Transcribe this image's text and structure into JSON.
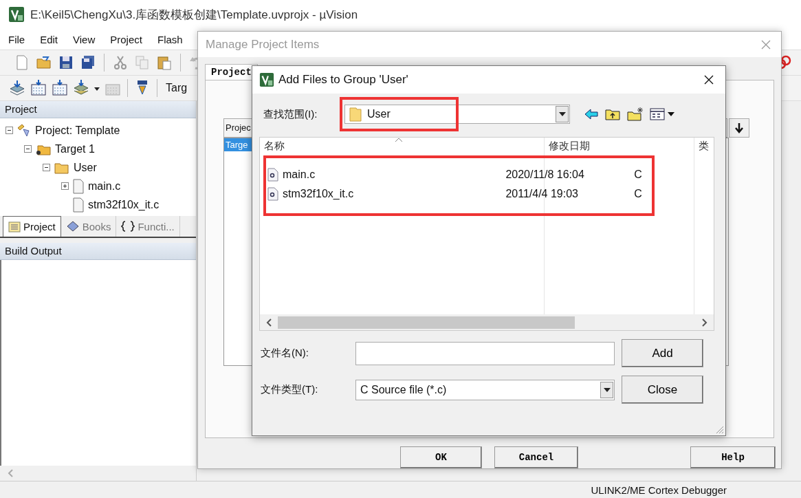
{
  "main_window": {
    "title": "E:\\Keil5\\ChengXu\\3.库函数模板创建\\Template.uvprojx - µVision",
    "menu": [
      "File",
      "Edit",
      "View",
      "Project",
      "Flash"
    ],
    "target_label": "Targ"
  },
  "project_panel": {
    "title": "Project",
    "tree": [
      {
        "label": "Project: Template",
        "kind": "project",
        "expanded": true,
        "children": [
          {
            "label": "Target 1",
            "kind": "target",
            "expanded": true,
            "children": [
              {
                "label": "User",
                "kind": "group",
                "expanded": true,
                "children": [
                  {
                    "label": "main.c",
                    "kind": "file",
                    "expanded": false
                  },
                  {
                    "label": "stm32f10x_it.c",
                    "kind": "file"
                  }
                ]
              }
            ]
          }
        ]
      }
    ],
    "tabs": [
      {
        "label": "Project",
        "kind": "project",
        "selected": true
      },
      {
        "label": "Books",
        "kind": "books",
        "selected": false
      },
      {
        "label": "Functi...",
        "kind": "functions",
        "selected": false
      }
    ]
  },
  "build_output": {
    "title": "Build Output"
  },
  "status_bar": {
    "debugger": "ULINK2/ME Cortex Debugger"
  },
  "manage_dialog": {
    "title": "Manage Project Items",
    "tab": "Project",
    "list_header": "Projec",
    "items": [
      {
        "label": "Targe",
        "selected": true
      }
    ],
    "buttons": [
      "OK",
      "Cancel",
      "Help"
    ]
  },
  "add_files_dialog": {
    "title": "Add Files to Group 'User'",
    "look_in": {
      "label": "查找范围(I):",
      "value": "User",
      "highlighted": true
    },
    "file_list": {
      "columns": [
        "名称",
        "修改日期",
        "类"
      ],
      "highlighted": true,
      "rows": [
        {
          "name": "main.c",
          "modified": "2020/11/8 16:04",
          "type": "C"
        },
        {
          "name": "stm32f10x_it.c",
          "modified": "2011/4/4 19:03",
          "type": "C"
        }
      ]
    },
    "file_name": {
      "label": "文件名(N):"
    },
    "file_type": {
      "label": "文件类型(T):",
      "value": "C Source file (*.c)"
    },
    "buttons": [
      "Add",
      "Close"
    ]
  }
}
